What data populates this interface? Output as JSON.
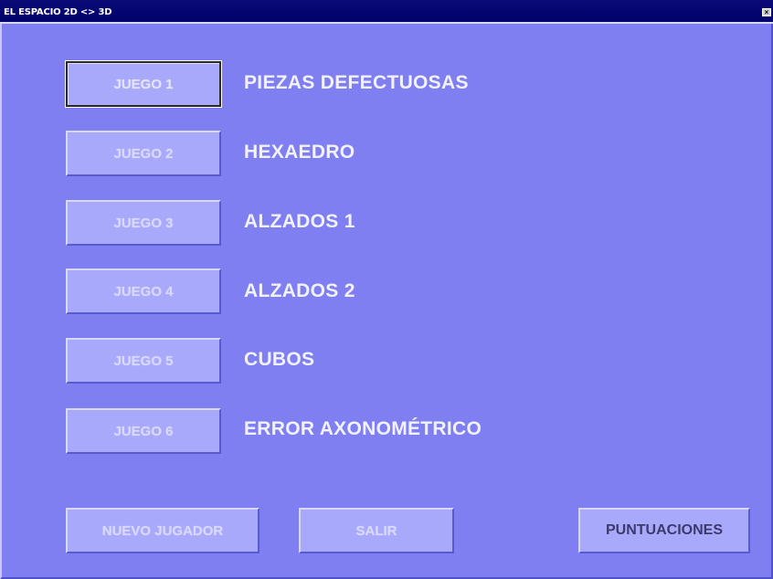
{
  "window": {
    "title": "EL ESPACIO 2D <> 3D",
    "close_label": "×"
  },
  "games": [
    {
      "button": "JUEGO 1",
      "label": "PIEZAS DEFECTUOSAS"
    },
    {
      "button": "JUEGO 2",
      "label": "HEXAEDRO"
    },
    {
      "button": "JUEGO 3",
      "label": "ALZADOS 1"
    },
    {
      "button": "JUEGO 4",
      "label": "ALZADOS 2"
    },
    {
      "button": "JUEGO 5",
      "label": "CUBOS"
    },
    {
      "button": "JUEGO 6",
      "label": "ERROR AXONOMÉTRICO"
    }
  ],
  "footer": {
    "new_player": "NUEVO JUGADOR",
    "exit": "SALIR",
    "scores": "PUNTUACIONES"
  },
  "colors": {
    "background": "#7f7ff2",
    "button": "#a9a9fb",
    "titlebar": "#00006a"
  }
}
